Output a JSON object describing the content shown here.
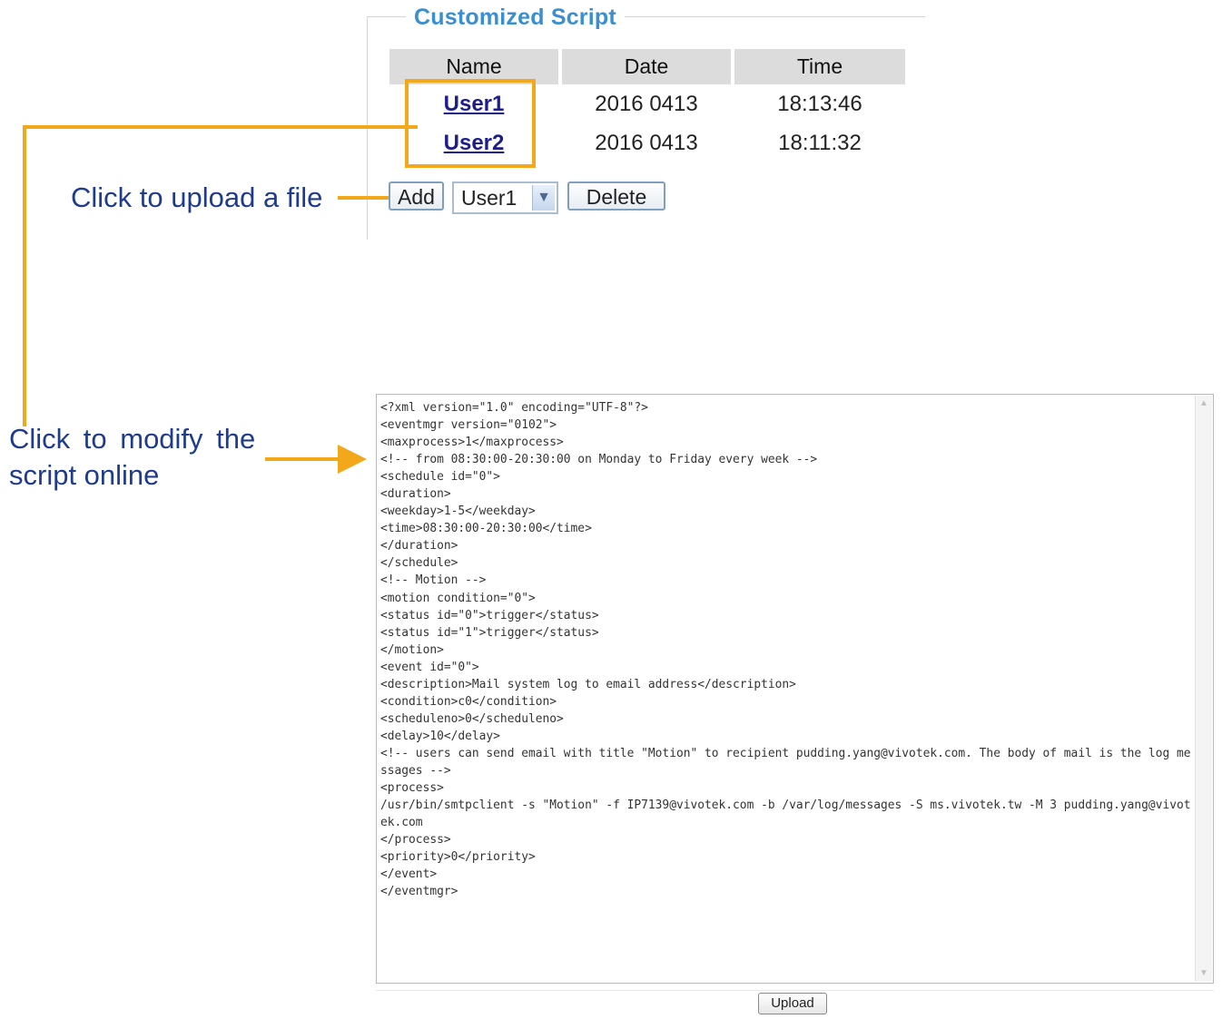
{
  "panel": {
    "legend": "Customized Script",
    "columns": [
      "Name",
      "Date",
      "Time"
    ],
    "rows": [
      {
        "name": "User1",
        "date": "2016 0413",
        "time": "18:13:46"
      },
      {
        "name": "User2",
        "date": "2016 0413",
        "time": "18:11:32"
      }
    ],
    "add_label": "Add",
    "select_value": "User1",
    "delete_label": "Delete"
  },
  "annotations": {
    "upload": "Click to upload a file",
    "modify_line1": "Click to modify the",
    "modify_line2": "script online",
    "color": "#f3a81c"
  },
  "editor": {
    "content": "<?xml version=\"1.0\" encoding=\"UTF-8\"?>\n<eventmgr version=\"0102\">\n<maxprocess>1</maxprocess>\n<!-- from 08:30:00-20:30:00 on Monday to Friday every week -->\n<schedule id=\"0\">\n<duration>\n<weekday>1-5</weekday>\n<time>08:30:00-20:30:00</time>\n</duration>\n</schedule>\n<!-- Motion -->\n<motion condition=\"0\">\n<status id=\"0\">trigger</status>\n<status id=\"1\">trigger</status>\n</motion>\n<event id=\"0\">\n<description>Mail system log to email address</description>\n<condition>c0</condition>\n<scheduleno>0</scheduleno>\n<delay>10</delay>\n<!-- users can send email with title \"Motion\" to recipient pudding.yang@vivotek.com. The body of mail is the log messages -->\n<process>\n/usr/bin/smtpclient -s \"Motion\" -f IP7139@vivotek.com -b /var/log/messages -S ms.vivotek.tw -M 3 pudding.yang@vivotek.com\n</process>\n<priority>0</priority>\n</event>\n</eventmgr>",
    "upload_label": "Upload"
  }
}
